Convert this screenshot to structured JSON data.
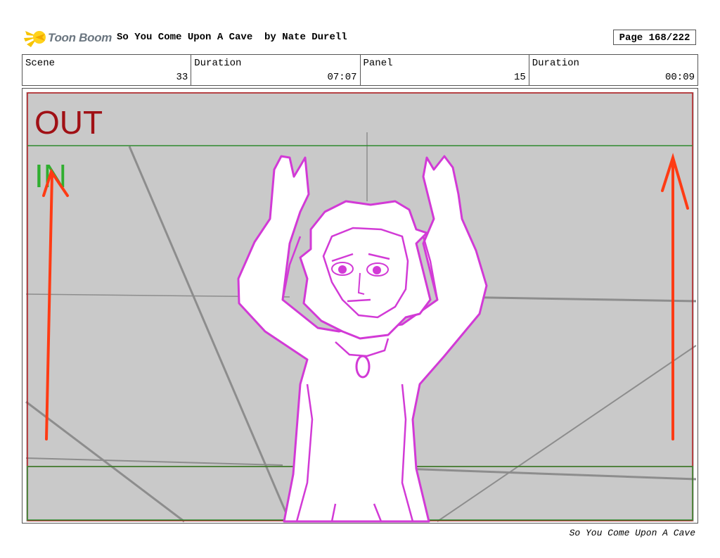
{
  "header": {
    "logo_text": "Toon Boom",
    "title": "So You Come Upon A Cave  by Nate Durell",
    "page": "Page 168/222"
  },
  "info": {
    "scene_label": "Scene",
    "scene_value": "33",
    "duration_label": "Duration",
    "duration_value": "07:07",
    "panel_label": "Panel",
    "panel_value": "15",
    "panel_duration_label": "Duration",
    "panel_duration_value": "00:09"
  },
  "panel": {
    "out_label": "OUT",
    "in_label": "IN"
  },
  "footer": {
    "text": "So You Come Upon A Cave"
  },
  "colors": {
    "out_frame": "#b0171b",
    "in_frame": "#2f8a2f",
    "arrow": "#ff3b14",
    "character": "#d23ad6",
    "background": "#c9c9c9"
  }
}
